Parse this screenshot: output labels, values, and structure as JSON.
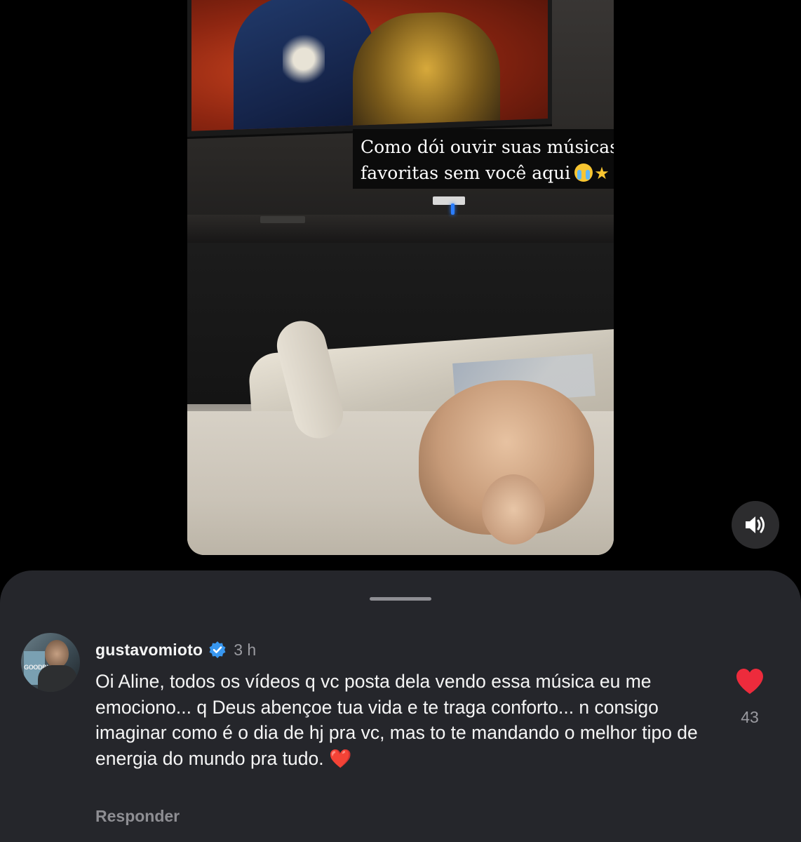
{
  "story": {
    "caption_line1": "Como dói ouvir suas músicas",
    "caption_line2": "favoritas sem você aqui",
    "caption_emojis": [
      "loudly-crying-face-emoji",
      "star-emoji"
    ]
  },
  "sound_button": {
    "icon": "speaker-on-icon"
  },
  "comment": {
    "username": "gustavomioto",
    "verified": true,
    "time": "3 h",
    "avatar_poster_text": "GOODBY",
    "text": "Oi Aline, todos os vídeos q vc posta dela vendo essa música eu me emociono... q Deus abençoe tua vida e te traga conforto... n consigo imaginar como é o dia de hj pra vc, mas to te mandando o melhor tipo de energia do mundo pra tudo.",
    "trailing_emoji": "❤️",
    "reply_label": "Responder",
    "like_count": "43",
    "liked": true
  },
  "colors": {
    "sheet_bg": "#25262b",
    "heart_red": "#ed2b3c",
    "verified_blue": "#3897f0",
    "secondary_text": "#9a9aa0"
  }
}
